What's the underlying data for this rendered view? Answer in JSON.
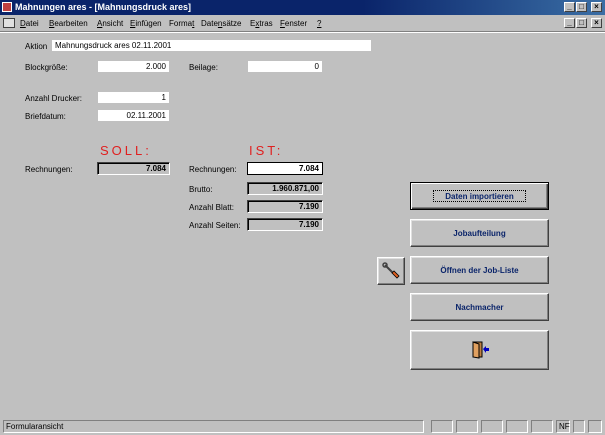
{
  "window": {
    "title": "Mahnungen ares - [Mahnungsdruck ares]"
  },
  "menu": {
    "items": [
      {
        "pre": "",
        "u": "D",
        "post": "atei"
      },
      {
        "pre": "",
        "u": "B",
        "post": "earbeiten"
      },
      {
        "pre": "",
        "u": "A",
        "post": "nsicht"
      },
      {
        "pre": "",
        "u": "E",
        "post": "infügen"
      },
      {
        "pre": "Forma",
        "u": "t",
        "post": ""
      },
      {
        "pre": "Date",
        "u": "n",
        "post": "sätze"
      },
      {
        "pre": "E",
        "u": "x",
        "post": "tras"
      },
      {
        "pre": "",
        "u": "F",
        "post": "enster"
      },
      {
        "pre": "",
        "u": "?",
        "post": ""
      }
    ]
  },
  "form": {
    "aktion_label": "Aktion",
    "aktion_value": "Mahnungsdruck ares 02.11.2001",
    "blockgroesse_label": "Blockgröße:",
    "blockgroesse_value": "2.000",
    "beilage_label": "Beilage:",
    "beilage_value": "0",
    "anzahl_drucker_label": "Anzahl Drucker:",
    "anzahl_drucker_value": "1",
    "briefdatum_label": "Briefdatum:",
    "briefdatum_value": "02.11.2001",
    "soll_header": "SOLL:",
    "ist_header": "IST:",
    "soll_rechnungen_label": "Rechnungen:",
    "soll_rechnungen_value": "7.084",
    "ist_rechnungen_label": "Rechnungen:",
    "ist_rechnungen_value": "7.084",
    "brutto_label": "Brutto:",
    "brutto_value": "1.960.871,00",
    "anzahl_blatt_label": "Anzahl Blatt:",
    "anzahl_blatt_value": "7.190",
    "anzahl_seiten_label": "Anzahl Seiten:",
    "anzahl_seiten_value": "7.190"
  },
  "buttons": {
    "daten_importieren": "Daten importieren",
    "jobaufteilung": "Jobaufteilung",
    "job_liste": "Öffnen der Job-Liste",
    "nachmacher": "Nachmacher",
    "tool_icon": "wrench-icon",
    "exit_icon": "exit-door-icon"
  },
  "status": {
    "text": "Formularansicht",
    "nf": "NF"
  },
  "colors": {
    "titlebar": "#0a246a",
    "header_red": "#e02020",
    "button_text": "#0a246a",
    "face": "#c0c0c0"
  }
}
